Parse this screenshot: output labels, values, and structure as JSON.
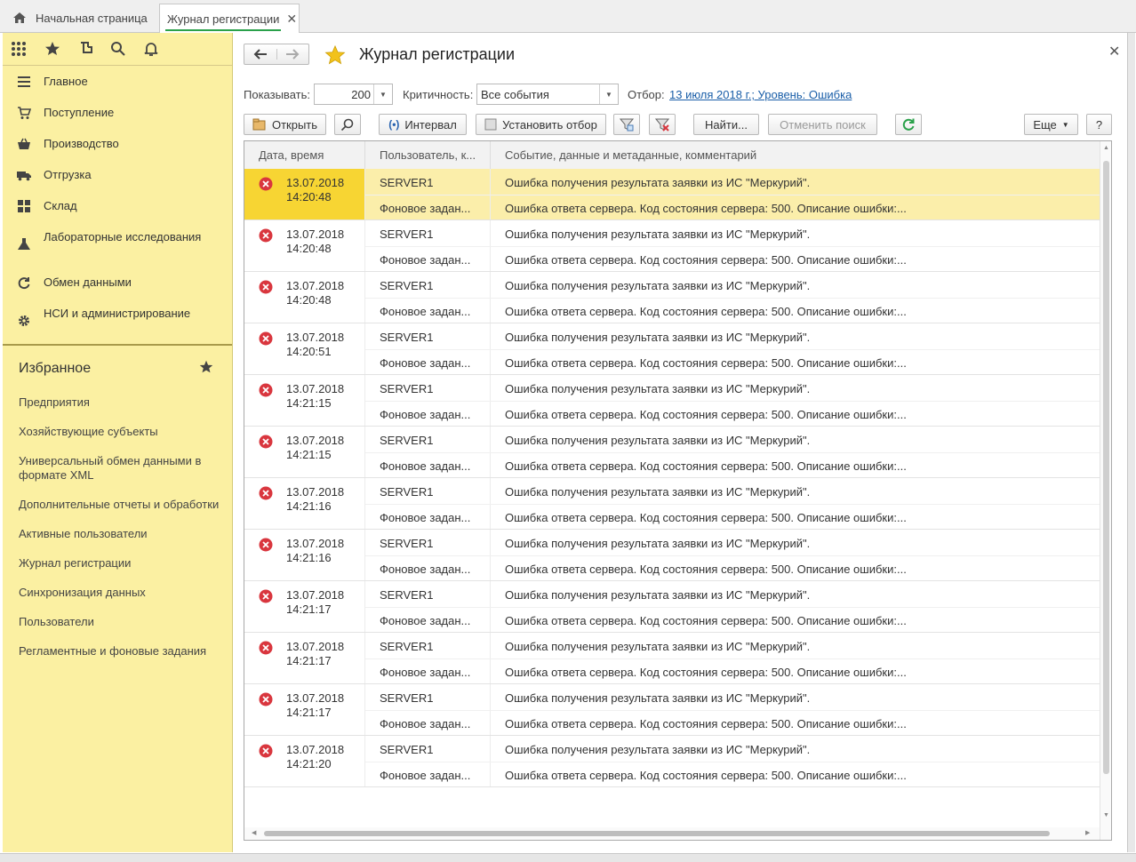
{
  "tabs": [
    {
      "label": "Начальная страница",
      "icon": "home-icon"
    },
    {
      "label": "Журнал регистрации",
      "icon": "close-icon"
    }
  ],
  "sidebar": {
    "menu": [
      {
        "label": "Главное",
        "icon": "menu-lines-icon"
      },
      {
        "label": "Поступление",
        "icon": "cart-icon"
      },
      {
        "label": "Производство",
        "icon": "basket-icon"
      },
      {
        "label": "Отгрузка",
        "icon": "truck-icon"
      },
      {
        "label": "Склад",
        "icon": "grid-icon"
      },
      {
        "label": "Лабораторные исследования",
        "icon": "flask-icon"
      },
      {
        "label": "Обмен данными",
        "icon": "refresh-icon"
      },
      {
        "label": "НСИ и администрирование",
        "icon": "gear-icon"
      }
    ],
    "favorites_title": "Избранное",
    "favorites": [
      "Предприятия",
      "Хозяйствующие субъекты",
      "Универсальный обмен данными в формате XML",
      "Дополнительные отчеты и обработки",
      "Активные пользователи",
      "Журнал регистрации",
      "Синхронизация данных",
      "Пользователи",
      "Регламентные и фоновые задания"
    ]
  },
  "form": {
    "title": "Журнал регистрации",
    "show_label": "Показывать:",
    "show_value": "200",
    "criticality_label": "Критичность:",
    "criticality_value": "Все события",
    "filter_label": "Отбор:",
    "filter_link": "13 июля 2018 г.; Уровень: Ошибка"
  },
  "toolbar": {
    "open": "Открыть",
    "interval": "Интервал",
    "set_filter": "Установить отбор",
    "find": "Найти...",
    "cancel_search": "Отменить поиск",
    "more": "Еще",
    "help": "?"
  },
  "table": {
    "headers": [
      "Дата, время",
      "Пользователь, к...",
      "Событие, данные и метаданные, комментарий"
    ],
    "rows": [
      {
        "date": "13.07.2018",
        "time": "14:20:48",
        "user": "SERVER1",
        "user2": "Фоновое задан...",
        "event": "Ошибка получения результата заявки из ИС \"Меркурий\".",
        "comment": "Ошибка ответа сервера. Код состояния сервера: 500. Описание ошибки:..."
      },
      {
        "date": "13.07.2018",
        "time": "14:20:48",
        "user": "SERVER1",
        "user2": "Фоновое задан...",
        "event": "Ошибка получения результата заявки из ИС \"Меркурий\".",
        "comment": "Ошибка ответа сервера. Код состояния сервера: 500. Описание ошибки:..."
      },
      {
        "date": "13.07.2018",
        "time": "14:20:48",
        "user": "SERVER1",
        "user2": "Фоновое задан...",
        "event": "Ошибка получения результата заявки из ИС \"Меркурий\".",
        "comment": "Ошибка ответа сервера. Код состояния сервера: 500. Описание ошибки:..."
      },
      {
        "date": "13.07.2018",
        "time": "14:20:51",
        "user": "SERVER1",
        "user2": "Фоновое задан...",
        "event": "Ошибка получения результата заявки из ИС \"Меркурий\".",
        "comment": "Ошибка ответа сервера. Код состояния сервера: 500. Описание ошибки:..."
      },
      {
        "date": "13.07.2018",
        "time": "14:21:15",
        "user": "SERVER1",
        "user2": "Фоновое задан...",
        "event": "Ошибка получения результата заявки из ИС \"Меркурий\".",
        "comment": "Ошибка ответа сервера. Код состояния сервера: 500. Описание ошибки:..."
      },
      {
        "date": "13.07.2018",
        "time": "14:21:15",
        "user": "SERVER1",
        "user2": "Фоновое задан...",
        "event": "Ошибка получения результата заявки из ИС \"Меркурий\".",
        "comment": "Ошибка ответа сервера. Код состояния сервера: 500. Описание ошибки:..."
      },
      {
        "date": "13.07.2018",
        "time": "14:21:16",
        "user": "SERVER1",
        "user2": "Фоновое задан...",
        "event": "Ошибка получения результата заявки из ИС \"Меркурий\".",
        "comment": "Ошибка ответа сервера. Код состояния сервера: 500. Описание ошибки:..."
      },
      {
        "date": "13.07.2018",
        "time": "14:21:16",
        "user": "SERVER1",
        "user2": "Фоновое задан...",
        "event": "Ошибка получения результата заявки из ИС \"Меркурий\".",
        "comment": "Ошибка ответа сервера. Код состояния сервера: 500. Описание ошибки:..."
      },
      {
        "date": "13.07.2018",
        "time": "14:21:17",
        "user": "SERVER1",
        "user2": "Фоновое задан...",
        "event": "Ошибка получения результата заявки из ИС \"Меркурий\".",
        "comment": "Ошибка ответа сервера. Код состояния сервера: 500. Описание ошибки:..."
      },
      {
        "date": "13.07.2018",
        "time": "14:21:17",
        "user": "SERVER1",
        "user2": "Фоновое задан...",
        "event": "Ошибка получения результата заявки из ИС \"Меркурий\".",
        "comment": "Ошибка ответа сервера. Код состояния сервера: 500. Описание ошибки:..."
      },
      {
        "date": "13.07.2018",
        "time": "14:21:17",
        "user": "SERVER1",
        "user2": "Фоновое задан...",
        "event": "Ошибка получения результата заявки из ИС \"Меркурий\".",
        "comment": "Ошибка ответа сервера. Код состояния сервера: 500. Описание ошибки:..."
      },
      {
        "date": "13.07.2018",
        "time": "14:21:20",
        "user": "SERVER1",
        "user2": "Фоновое задан...",
        "event": "Ошибка получения результата заявки из ИС \"Меркурий\".",
        "comment": "Ошибка ответа сервера. Код состояния сервера: 500. Описание ошибки:..."
      }
    ]
  },
  "colors": {
    "sidebar_bg": "#fbf0a2",
    "selected_row": "#fbeeaa",
    "selected_cell": "#f7d533",
    "error_icon": "#d9363e",
    "link": "#1a5ea8",
    "accent_green": "#2aa14a"
  }
}
